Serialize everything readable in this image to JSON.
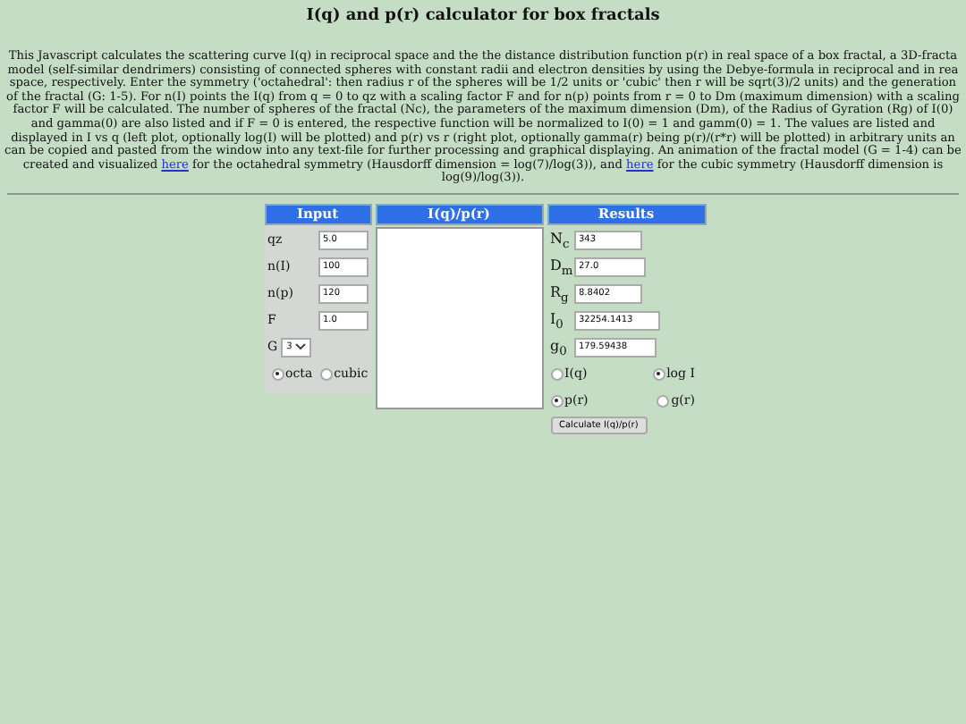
{
  "title": "I(q) and p(r) calculator for box fractals",
  "intro": [
    {
      "kind": "text",
      "text": "This Javascript calculates the scattering curve I(q) in reciprocal space and the the distance distribution function p(r) in real space of a box fractal, a 3D-fracta model (self-similar dendrimers) consisting of connected spheres with constant radii and electron densities by using the Debye-formula in reciprocal and in rea space, respectively. Enter the symmetry ('octahedral': then radius r of the spheres will be 1/2 units or 'cubic' then r will be sqrt(3)/2 units) and the generation of the fractal (G: 1-5). For n(I) points the I(q) from q = 0 to qz with a scaling factor F and for n(p) points from r = 0 to Dm (maximum dimension) with a scaling factor F will be calculated. The number of spheres of the fractal (Nc), the parameters of the maximum dimension (Dm), of the Radius of Gyration (Rg) of I(0) and gamma(0) are also listed and if F = 0 is entered, the respective function will be normalized to I(0) = 1 and gamm(0) = 1. The values are listed and displayed in I vs q (left plot, optionally log(I) will be plotted) and p(r) vs r (right plot, optionally gamma(r) being p(r)/(r*r) will be plotted) in arbitrary units an can be copied and pasted from the window into any text-file for further processing and graphical displaying. An animation of the fractal model (G = 1-4) can be created and visualized"
    },
    {
      "kind": "link",
      "text": "here"
    },
    {
      "kind": "text",
      "text": "for the octahedral symmetry (Hausdorff dimension = log(7)/log(3)), and"
    },
    {
      "kind": "link",
      "text": "here"
    },
    {
      "kind": "text",
      "text": "for the cubic symmetry (Hausdorff dimension is log(9)/log(3))."
    }
  ],
  "input": {
    "header": "Input",
    "fields": [
      {
        "label": "qz",
        "value": "5.0"
      },
      {
        "label": "n(I)",
        "value": "100"
      },
      {
        "label": "n(p)",
        "value": "120"
      },
      {
        "label": "F",
        "value": "1.0"
      }
    ],
    "generation": {
      "label": "G",
      "value": "3"
    },
    "symmetry": [
      {
        "label": "octa",
        "selected": true
      },
      {
        "label": "cubic",
        "selected": false
      }
    ]
  },
  "output": {
    "header": "I(q)/p(r)"
  },
  "results": {
    "header": "Results",
    "fields": [
      {
        "label": "N$_{c}$",
        "value": "343"
      },
      {
        "label": "D$_{m}$",
        "value": "27.0"
      },
      {
        "label": "R$_{g}$",
        "value": "8.8402"
      },
      {
        "label": "I$_{0}$",
        "value": "32254.1413"
      },
      {
        "label": "g$_{0}$",
        "value": "179.59438"
      }
    ],
    "scale": [
      {
        "label": "I(q)",
        "selected": false
      },
      {
        "label": "log I",
        "selected": true
      }
    ],
    "plot": [
      {
        "label": "p(r)",
        "selected": true
      },
      {
        "label": "g(r)",
        "selected": false
      }
    ],
    "button": "Calculate I(q)/p(r)"
  }
}
